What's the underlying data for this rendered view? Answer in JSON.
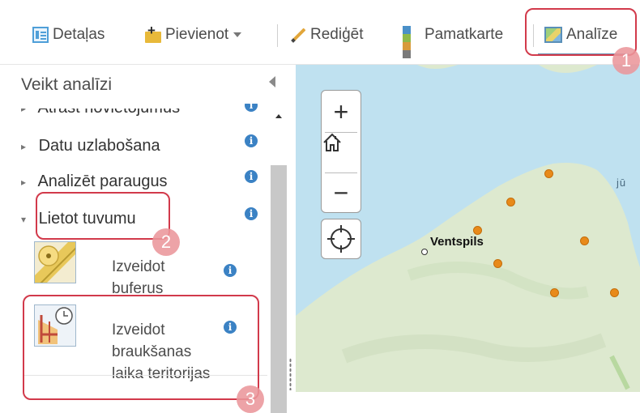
{
  "toolbar": {
    "details_label": "Detaļas",
    "add_label": "Pievienot",
    "edit_label": "Rediģēt",
    "basemap_label": "Pamatkarte",
    "analysis_label": "Analīze",
    "basemap_colors": [
      "#4a90c8",
      "#8fb94a",
      "#d89a3a",
      "#7a7a7a"
    ]
  },
  "panel": {
    "title": "Veikt analīzi",
    "groups": [
      {
        "label": "Atrast novietojumus",
        "arrow": "▸"
      },
      {
        "label": "Datu uzlabošana",
        "arrow": "▸"
      },
      {
        "label": "Analizēt paraugus",
        "arrow": "▸"
      },
      {
        "label": "Lietot tuvumu",
        "arrow": "▾"
      }
    ],
    "tools": [
      {
        "label_line1": "Izveidot",
        "label_line2": "buferus",
        "icon": "create-buffers-icon"
      },
      {
        "label_line1": "Izveidot",
        "label_line2": "braukšanas",
        "label_line3": "laika teritorijas",
        "icon": "drive-time-areas-icon"
      }
    ],
    "info_glyph": "i"
  },
  "map": {
    "zoom_in": "+",
    "zoom_out": "−",
    "city_label": "Ventspils",
    "sea_label": "jū",
    "poi_color": "#e88a1a",
    "land_color": "#dde9cf",
    "water_color": "#bfe1f0"
  },
  "annotations": {
    "color": "#d23a4b",
    "steps": [
      "1",
      "2",
      "3"
    ]
  }
}
